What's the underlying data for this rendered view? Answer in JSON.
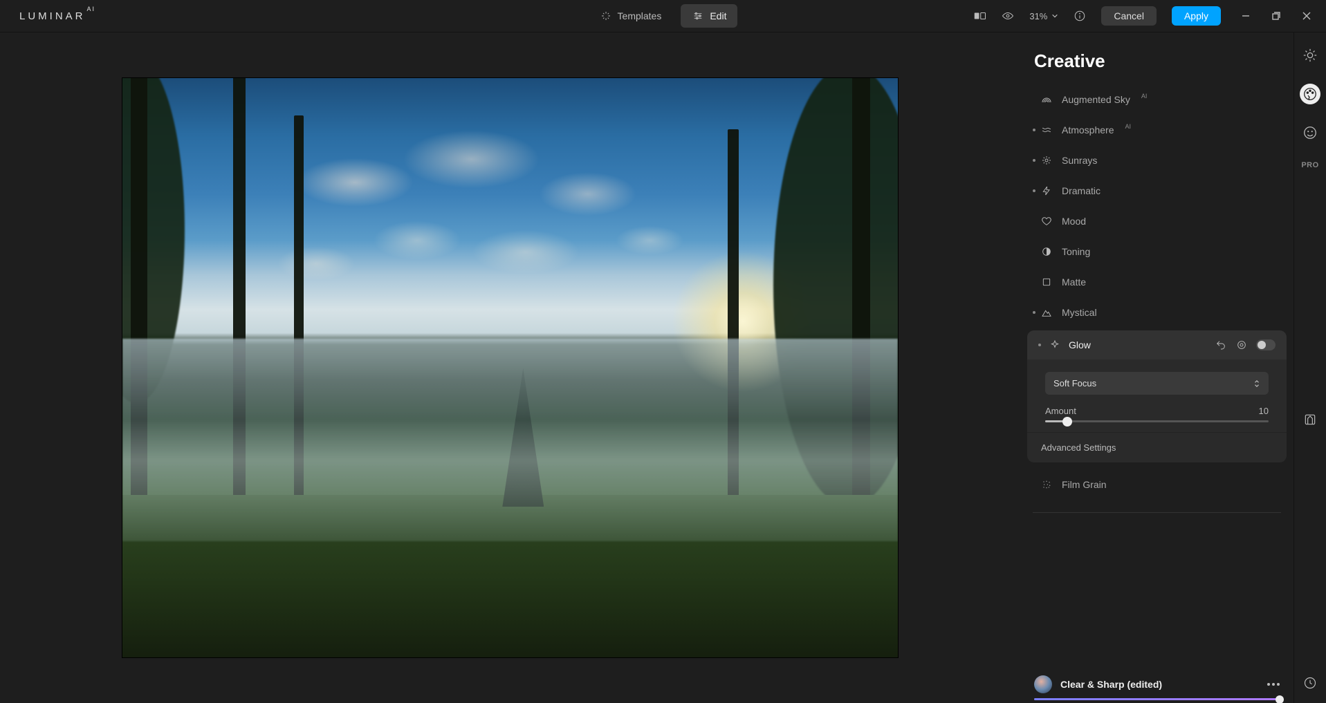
{
  "app": {
    "name": "LUMINAR",
    "suffix": "AI"
  },
  "topbar": {
    "templates": "Templates",
    "edit": "Edit",
    "zoom": "31%",
    "cancel": "Cancel",
    "apply": "Apply"
  },
  "panel": {
    "title": "Creative",
    "tools": {
      "augmented_sky": "Augmented Sky",
      "atmosphere": "Atmosphere",
      "sunrays": "Sunrays",
      "dramatic": "Dramatic",
      "mood": "Mood",
      "toning": "Toning",
      "matte": "Matte",
      "mystical": "Mystical",
      "glow": "Glow",
      "film_grain": "Film Grain"
    },
    "glow": {
      "mode": "Soft Focus",
      "amount_label": "Amount",
      "amount_value": "10",
      "advanced": "Advanced Settings"
    }
  },
  "preset": {
    "name": "Clear & Sharp (edited)"
  },
  "rail": {
    "pro": "PRO"
  }
}
